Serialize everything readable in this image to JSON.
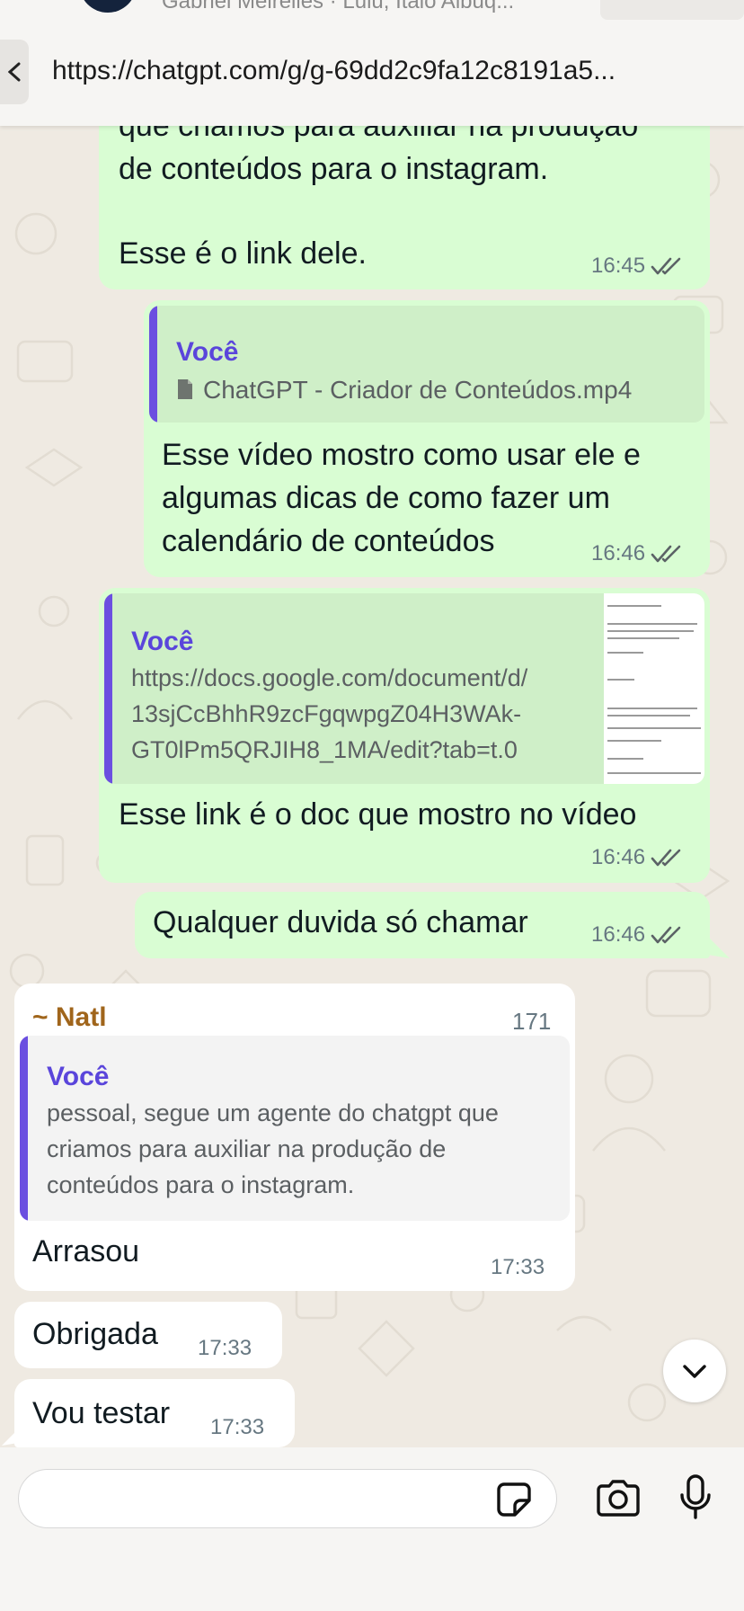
{
  "header": {
    "subtitle": "Gabriel Meirelles · Lulu, Italo Albuq...",
    "url": "https://chatgpt.com/g/g-69dd2c9fa12c8191a5..."
  },
  "messages": [
    {
      "id": "m1",
      "direction": "outgoing",
      "lines": [
        "que criamos para auxiliar na produção",
        "de conteúdos para o instagram.",
        "",
        "Esse é o link dele."
      ],
      "time": "16:45",
      "status": "read"
    },
    {
      "id": "m2",
      "direction": "outgoing",
      "quote": {
        "author": "Você",
        "file_icon": "file-icon",
        "file_name": "ChatGPT - Criador de Conteúdos.mp4"
      },
      "lines": [
        "Esse vídeo mostro como usar ele e",
        "algumas dicas de como fazer um",
        "calendário de conteúdos"
      ],
      "time": "16:46",
      "status": "read"
    },
    {
      "id": "m3",
      "direction": "outgoing",
      "quote": {
        "author": "Você",
        "lines": [
          "https://docs.google.com/document/d/",
          "13sjCcBhhR9zcFgqwpgZ04H3WAk-",
          "GT0lPm5QRJIH8_1MA/edit?tab=t.0"
        ]
      },
      "lines": [
        "Esse link é o doc que mostro no vídeo"
      ],
      "time": "16:46",
      "status": "read"
    },
    {
      "id": "m4",
      "direction": "outgoing",
      "lines": [
        "Qualquer duvida só chamar"
      ],
      "time": "16:46",
      "status": "read"
    },
    {
      "id": "m5",
      "direction": "incoming",
      "sender": "~ Natl",
      "sender_count": "171",
      "quote": {
        "author": "Você",
        "lines": [
          "pessoal, segue um agente do chatgpt que",
          "criamos para auxiliar na produção de",
          "conteúdos para o instagram."
        ]
      },
      "lines": [
        "Arrasou"
      ],
      "time": "17:33"
    },
    {
      "id": "m6",
      "direction": "incoming",
      "lines": [
        "Obrigada"
      ],
      "time": "17:33"
    },
    {
      "id": "m7",
      "direction": "incoming",
      "lines": [
        "Vou testar"
      ],
      "time": "17:33"
    }
  ],
  "composer": {
    "value": "",
    "sticker_icon": "sticker-icon",
    "camera_icon": "camera-icon",
    "mic_icon": "microphone-icon"
  },
  "colors": {
    "outgoing_bubble": "#d9fdd3",
    "incoming_bubble": "#ffffff",
    "quote_accent": "#6b4fe0",
    "sender_name": "#a0651b",
    "chat_background": "#efeae2",
    "read_ticks": "#5b6266"
  }
}
